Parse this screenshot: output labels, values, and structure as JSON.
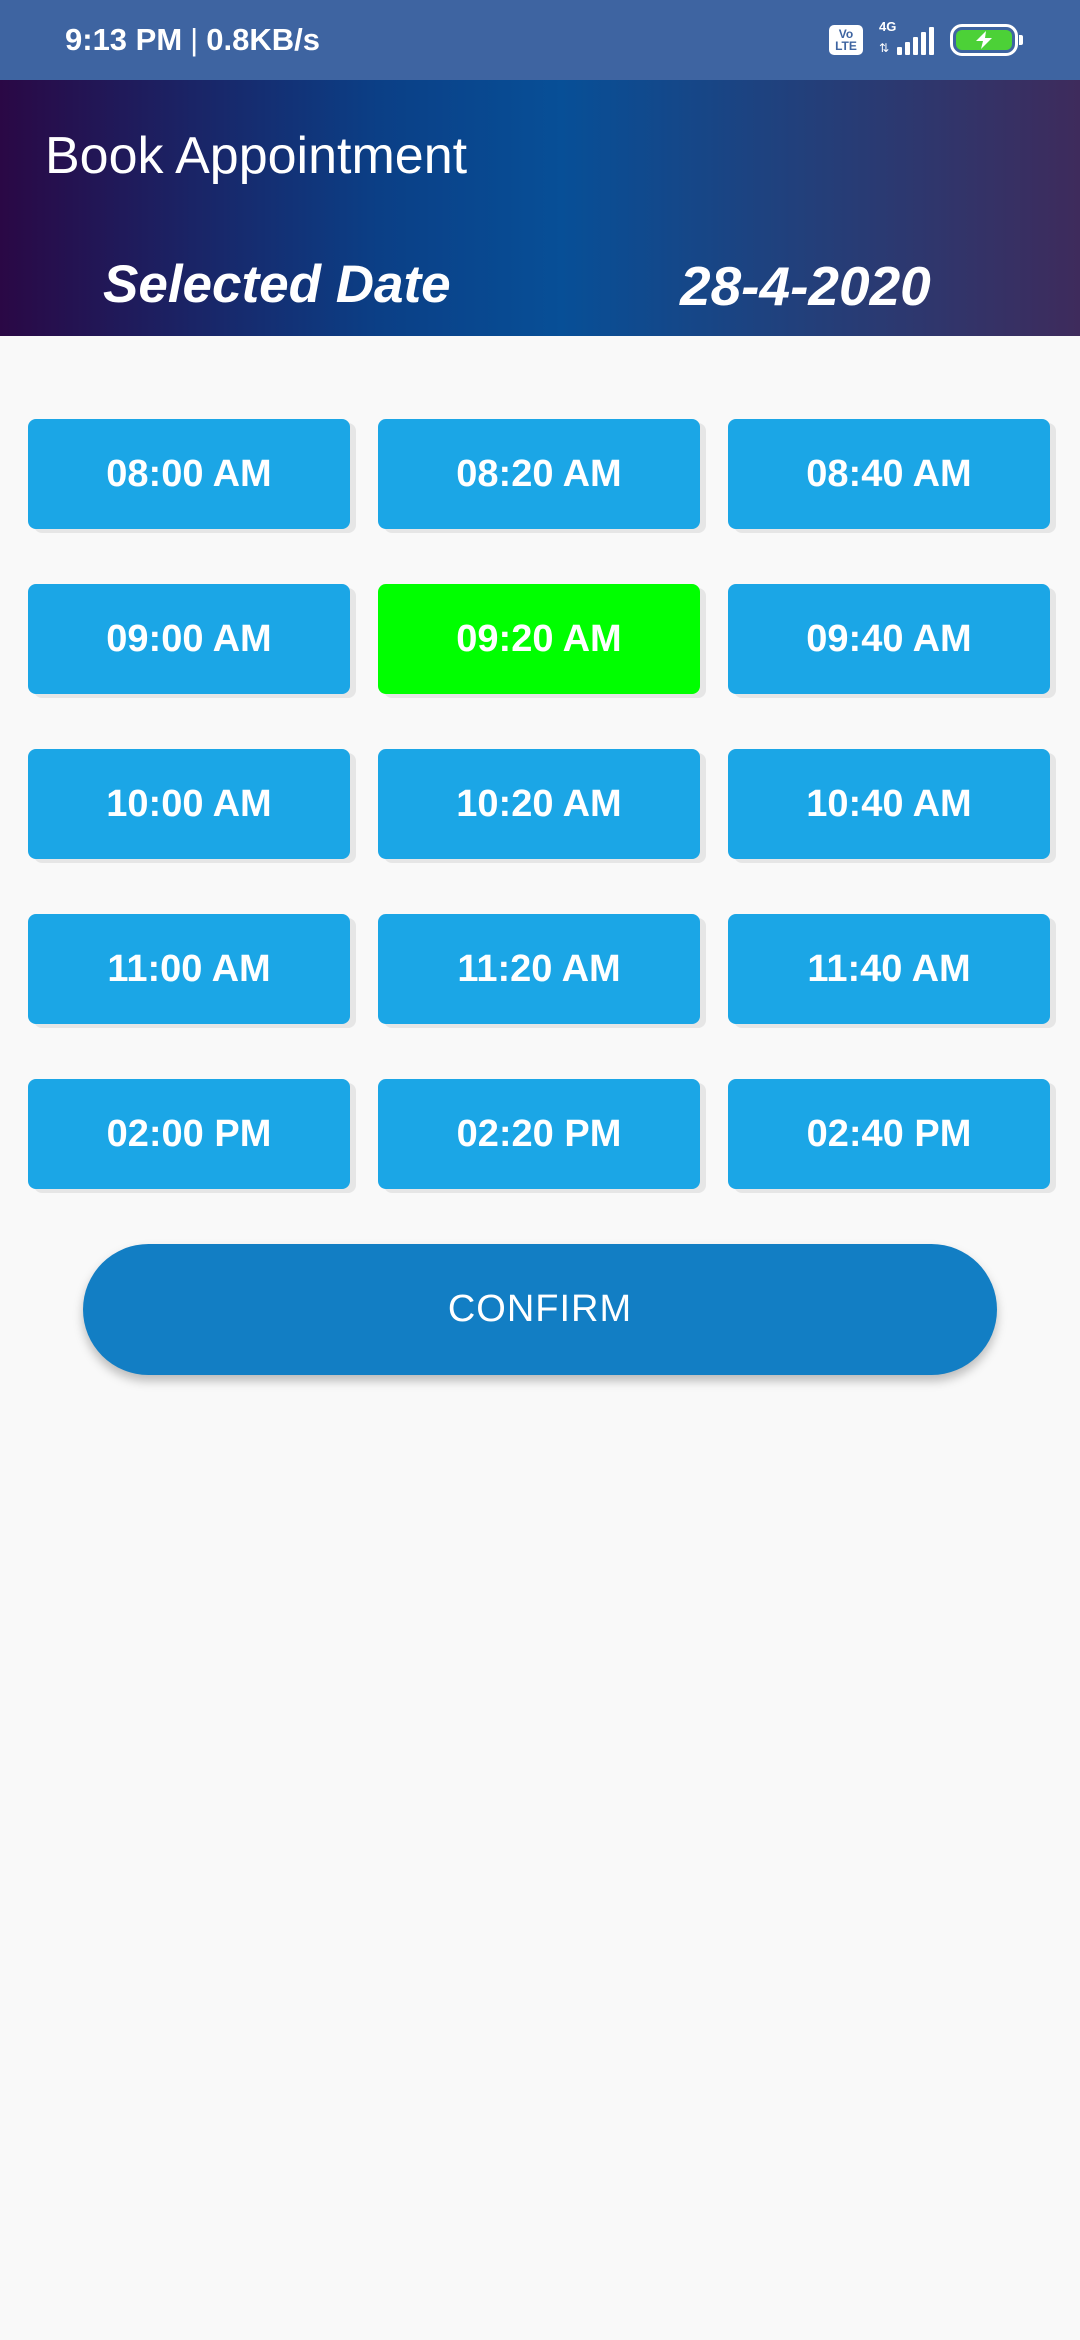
{
  "status_bar": {
    "time": "9:13 PM",
    "separator": "|",
    "speed": "0.8KB/s",
    "volte_top": "Vo",
    "volte_bottom": "LTE",
    "network": "4G",
    "icons": [
      "volte-icon",
      "signal-icon",
      "battery-charging-icon"
    ],
    "battery_color": "#4cd137"
  },
  "header": {
    "title": "Book Appointment",
    "selected_date_label": "Selected Date",
    "selected_date_value": "28-4-2020"
  },
  "colors": {
    "slot": "#1ba6e6",
    "slot_selected": "#00ff00",
    "confirm": "#127ec4"
  },
  "slots": [
    {
      "label": "08:00 AM",
      "selected": false
    },
    {
      "label": "08:20 AM",
      "selected": false
    },
    {
      "label": "08:40 AM",
      "selected": false
    },
    {
      "label": "09:00 AM",
      "selected": false
    },
    {
      "label": "09:20 AM",
      "selected": true
    },
    {
      "label": "09:40 AM",
      "selected": false
    },
    {
      "label": "10:00 AM",
      "selected": false
    },
    {
      "label": "10:20 AM",
      "selected": false
    },
    {
      "label": "10:40 AM",
      "selected": false
    },
    {
      "label": "11:00 AM",
      "selected": false
    },
    {
      "label": "11:20 AM",
      "selected": false
    },
    {
      "label": "11:40 AM",
      "selected": false
    },
    {
      "label": "02:00 PM",
      "selected": false
    },
    {
      "label": "02:20 PM",
      "selected": false
    },
    {
      "label": "02:40 PM",
      "selected": false
    }
  ],
  "confirm_label": "CONFIRM"
}
